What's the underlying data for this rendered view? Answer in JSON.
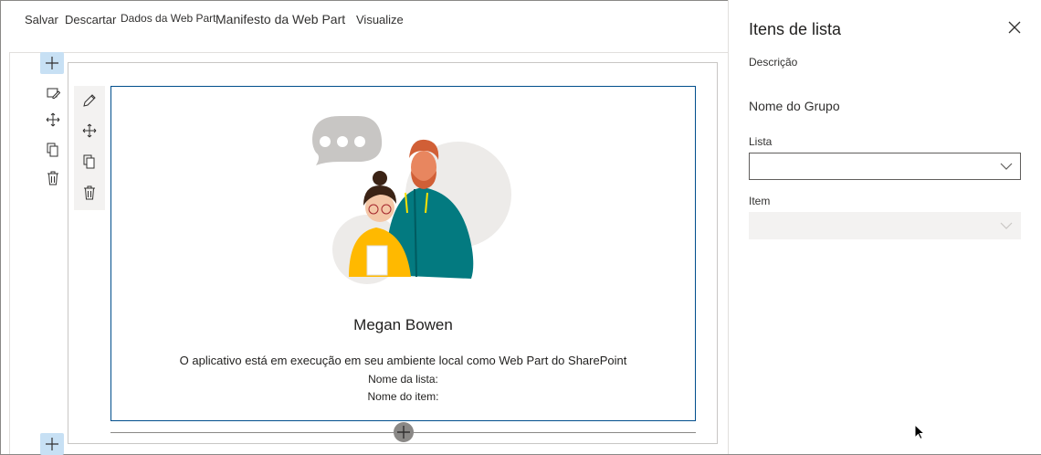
{
  "toolbar": {
    "save_label": "Salvar",
    "discard_label": "Descartar",
    "webpart_data_label": "Dados da Web Part",
    "webpart_manifest_label": "Manifesto da Web Part",
    "visualize_label": "Visualize"
  },
  "canvas": {
    "section_tools": [
      "edit-section-icon",
      "move-icon",
      "duplicate-icon",
      "delete-icon"
    ],
    "webpart_tools": [
      "pencil-icon",
      "move-icon",
      "duplicate-icon",
      "delete-icon"
    ]
  },
  "webpart": {
    "user_name": "Megan Bowen",
    "description": "O aplicativo está em execução em seu ambiente local como Web Part do SharePoint",
    "list_name_label": "Nome da lista:",
    "item_name_label": "Nome do item:"
  },
  "pane": {
    "title": "Itens de lista",
    "description": "Descrição",
    "group_name": "Nome do Grupo",
    "list_label": "Lista",
    "list_value": "",
    "item_label": "Item",
    "item_value": ""
  },
  "colors": {
    "accent_light": "#c7e0f4",
    "webpart_border": "#004e8c",
    "disabled_bg": "#f3f2f1"
  }
}
